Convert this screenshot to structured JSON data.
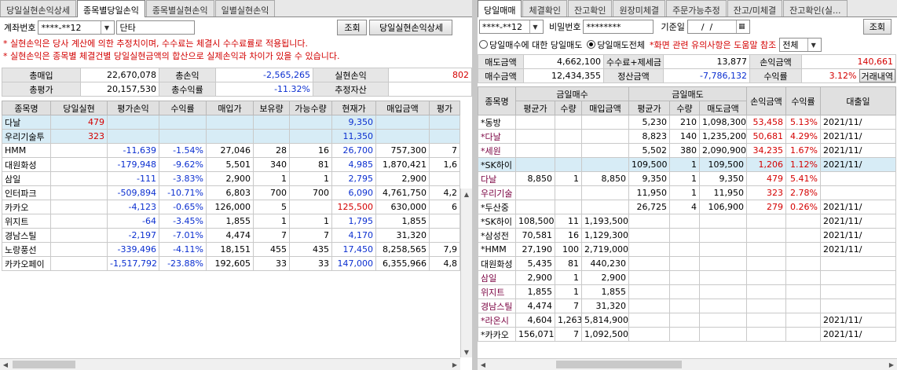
{
  "left": {
    "tabs": [
      "당일실현손익상세",
      "종목별당일손익",
      "종목별실현손익",
      "일별실현손익"
    ],
    "active_tab": 1,
    "account_label": "계좌번호",
    "account_value": "****-**12",
    "account_type": "단타",
    "search_label": "조회",
    "detail_label": "당일실현손익상세",
    "warnings": [
      "* 실현손익은 당사 계산에 의한 추정치이며, 수수료는 체결시 수수료률로 적용됩니다.",
      "* 실현손익은 종목별 체결건별 당일실현금액의 합산으로 실제손익과 차이가 있을 수 있습니다."
    ],
    "summary": [
      [
        "총매입",
        "22,670,078",
        "총손익",
        "-2,565,265",
        "실현손익",
        "802"
      ],
      [
        "총평가",
        "20,157,530",
        "총수익률",
        "-11.32%",
        "추정자산",
        ""
      ]
    ],
    "columns": [
      "종목명",
      "당일실현",
      "평가손익",
      "수익률",
      "매입가",
      "보유량",
      "가능수량",
      "현재가",
      "매입금액",
      "평가"
    ],
    "rows": [
      [
        "다날",
        "479",
        "",
        "",
        "",
        "",
        "",
        "9,350",
        "",
        ""
      ],
      [
        "우리기술투",
        "323",
        "",
        "",
        "",
        "",
        "",
        "11,350",
        "",
        ""
      ],
      [
        "HMM",
        "",
        "-11,639",
        "-1.54%",
        "27,046",
        "28",
        "16",
        "26,700",
        "757,300",
        "7"
      ],
      [
        "대원화성",
        "",
        "-179,948",
        "-9.62%",
        "5,501",
        "340",
        "81",
        "4,985",
        "1,870,421",
        "1,6"
      ],
      [
        "삼일",
        "",
        "-111",
        "-3.83%",
        "2,900",
        "1",
        "1",
        "2,795",
        "2,900",
        ""
      ],
      [
        "인터파크",
        "",
        "-509,894",
        "-10.71%",
        "6,803",
        "700",
        "700",
        "6,090",
        "4,761,750",
        "4,2"
      ],
      [
        "카카오",
        "",
        "-4,123",
        "-0.65%",
        "126,000",
        "5",
        "",
        "125,500",
        "630,000",
        "6"
      ],
      [
        "위지트",
        "",
        "-64",
        "-3.45%",
        "1,855",
        "1",
        "1",
        "1,795",
        "1,855",
        ""
      ],
      [
        "경남스틸",
        "",
        "-2,197",
        "-7.01%",
        "4,474",
        "7",
        "7",
        "4,170",
        "31,320",
        ""
      ],
      [
        "노랑풍선",
        "",
        "-339,496",
        "-4.11%",
        "18,151",
        "455",
        "435",
        "17,450",
        "8,258,565",
        "7,9"
      ],
      [
        "카카오페이",
        "",
        "-1,517,792",
        "-23.88%",
        "192,605",
        "33",
        "33",
        "147,000",
        "6,355,966",
        "4,8"
      ]
    ]
  },
  "right": {
    "tabs": [
      "당일매매",
      "체결확인",
      "잔고확인",
      "원장미체결",
      "주문가능추정",
      "잔고/미체결",
      "잔고확인(실..."
    ],
    "active_tab": 0,
    "account_value": "****-**12",
    "password_label": "비밀번호",
    "password_value": "********",
    "date_label": "기준일",
    "date_value": "    /  /",
    "search_label": "조회",
    "radio1_label": "당일매수에 대한 당일매도",
    "radio2_label": "당일매도전체",
    "notice": "*화면 관련 유의사항은 도움말 참조",
    "filter_value": "전체",
    "summary": [
      [
        "매도금액",
        "4,662,100",
        "수수료+제세금",
        "13,877",
        "손익금액",
        "140,661"
      ],
      [
        "매수금액",
        "12,434,355",
        "정산금액",
        "-7,786,132",
        "수익률",
        "3.12%",
        "거래내역"
      ]
    ],
    "group_headers": [
      "종목명",
      "금일매수",
      "금일매도",
      "손익금액",
      "수익률",
      "대출일"
    ],
    "sub_headers": [
      "평균가",
      "수량",
      "매입금액",
      "평균가",
      "수량",
      "매도금액"
    ],
    "rows": [
      [
        "*동방",
        "",
        "",
        "",
        "5,230",
        "210",
        "1,098,300",
        "53,458",
        "5.13%",
        "2021/11/"
      ],
      [
        "*다날",
        "",
        "",
        "",
        "8,823",
        "140",
        "1,235,200",
        "50,681",
        "4.29%",
        "2021/11/"
      ],
      [
        "*세원",
        "",
        "",
        "",
        "5,502",
        "380",
        "2,090,900",
        "34,235",
        "1.67%",
        "2021/11/"
      ],
      [
        "*SK하이",
        "",
        "",
        "",
        "109,500",
        "1",
        "109,500",
        "1,206",
        "1.12%",
        "2021/11/"
      ],
      [
        "다날",
        "8,850",
        "1",
        "8,850",
        "9,350",
        "1",
        "9,350",
        "479",
        "5.41%",
        ""
      ],
      [
        "우리기술",
        "",
        "",
        "",
        "11,950",
        "1",
        "11,950",
        "323",
        "2.78%",
        ""
      ],
      [
        "*두산중",
        "",
        "",
        "",
        "26,725",
        "4",
        "106,900",
        "279",
        "0.26%",
        "2021/11/"
      ],
      [
        "*SK하이",
        "108,500",
        "11",
        "1,193,500",
        "",
        "",
        "",
        "",
        "",
        "2021/11/"
      ],
      [
        "*삼성전",
        "70,581",
        "16",
        "1,129,300",
        "",
        "",
        "",
        "",
        "",
        "2021/11/"
      ],
      [
        "*HMM",
        "27,190",
        "100",
        "2,719,000",
        "",
        "",
        "",
        "",
        "",
        "2021/11/"
      ],
      [
        "대원화성",
        "5,435",
        "81",
        "440,230",
        "",
        "",
        "",
        "",
        "",
        ""
      ],
      [
        "삼일",
        "2,900",
        "1",
        "2,900",
        "",
        "",
        "",
        "",
        "",
        ""
      ],
      [
        "위지트",
        "1,855",
        "1",
        "1,855",
        "",
        "",
        "",
        "",
        "",
        ""
      ],
      [
        "경남스틸",
        "4,474",
        "7",
        "31,320",
        "",
        "",
        "",
        "",
        "",
        ""
      ],
      [
        "*라온시",
        "4,604",
        "1,263",
        "5,814,900",
        "",
        "",
        "",
        "",
        "",
        "2021/11/"
      ],
      [
        "*카카오",
        "156,071",
        "7",
        "1,092,500",
        "",
        "",
        "",
        "",
        "",
        "2021/11/"
      ]
    ],
    "name_colors": [
      "black",
      "pur",
      "pur",
      "black",
      "pur",
      "pur",
      "black",
      "black",
      "black",
      "black",
      "black",
      "pur",
      "pur",
      "pur",
      "pur",
      "black"
    ]
  }
}
